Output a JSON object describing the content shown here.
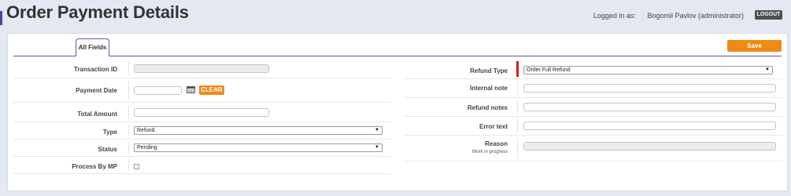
{
  "header": {
    "title": "Order Payment Details",
    "logged_in_label": "Logged in as:",
    "user_name": "Bogomil Pavlov (administrator)",
    "logout_label": "LOGOUT"
  },
  "tabs": [
    {
      "label": "All Fields",
      "active": true
    }
  ],
  "toolbar": {
    "save_label": "Save"
  },
  "left_fields": {
    "transaction_id": {
      "label": "Transaction ID",
      "value": ""
    },
    "payment_date": {
      "label": "Payment Date",
      "value": "",
      "clear_label": "CLEAR"
    },
    "total_amount": {
      "label": "Total Amount",
      "value": ""
    },
    "type": {
      "label": "Type",
      "value": "Refund"
    },
    "status": {
      "label": "Status",
      "value": "Pending"
    },
    "process_by_mp": {
      "label": "Process By MP",
      "checked": false
    }
  },
  "right_fields": {
    "refund_type": {
      "label": "Refund Type",
      "value": "Order Full Refund"
    },
    "internal_note": {
      "label": "Internal note",
      "value": ""
    },
    "refund_notes": {
      "label": "Refund notes",
      "value": ""
    },
    "error_text": {
      "label": "Error text",
      "value": ""
    },
    "reason": {
      "label": "Reason",
      "note": "Work in progress",
      "value": ""
    }
  },
  "colors": {
    "accent": "#6f4fa3",
    "primary_button": "#f08a17",
    "required_marker": "#d81b1b",
    "logout_button": "#4f4f4f"
  }
}
